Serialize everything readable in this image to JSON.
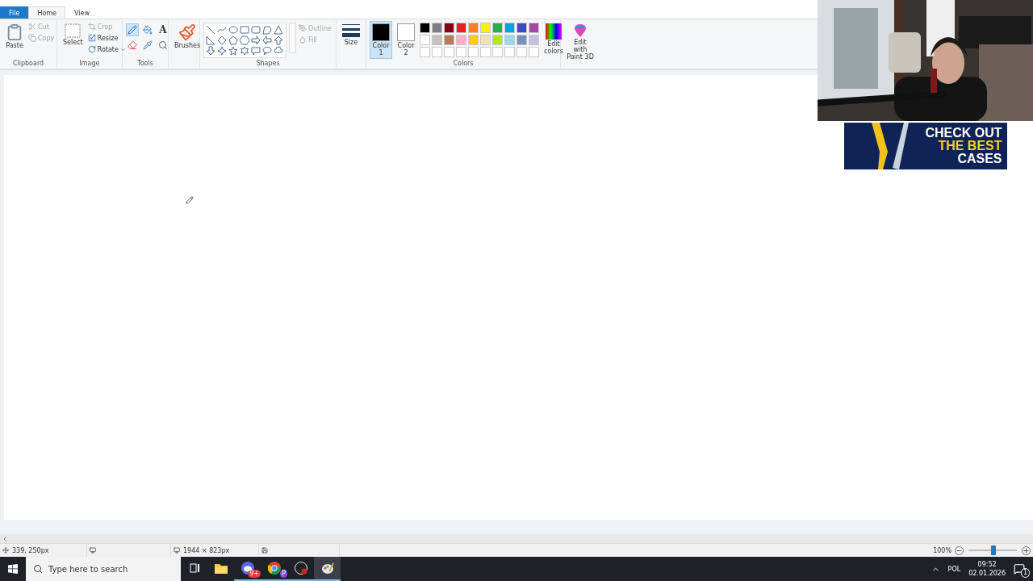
{
  "tabs": [
    {
      "label": "File",
      "kind": "file",
      "selected": false
    },
    {
      "label": "Home",
      "kind": "tab",
      "selected": true
    },
    {
      "label": "View",
      "kind": "tab",
      "selected": false
    }
  ],
  "ribbon": {
    "clipboard": {
      "label": "Clipboard",
      "paste": "Paste",
      "small": [
        {
          "label": "Cut",
          "kind": "cut",
          "disabled": true
        },
        {
          "label": "Copy",
          "kind": "copy",
          "disabled": true
        }
      ]
    },
    "image": {
      "label": "Image",
      "select": "Select",
      "small": [
        {
          "label": "Crop",
          "kind": "crop",
          "disabled": true
        },
        {
          "label": "Resize",
          "kind": "resize",
          "disabled": false
        },
        {
          "label": "Rotate",
          "kind": "rotate",
          "disabled": false
        }
      ]
    },
    "tools": {
      "label": "Tools",
      "items": [
        {
          "kind": "pencil",
          "selected": true
        },
        {
          "kind": "fill",
          "selected": false
        },
        {
          "kind": "text",
          "glyph": "A",
          "selected": false
        },
        {
          "kind": "eraser",
          "selected": false
        },
        {
          "kind": "picker",
          "selected": false
        },
        {
          "kind": "magnifier",
          "selected": false
        }
      ]
    },
    "brushes": {
      "button": "Brushes"
    },
    "shapes": {
      "label": "Shapes",
      "outline": {
        "label": "Outline",
        "disabled": true
      },
      "fill": {
        "label": "Fill",
        "disabled": true
      }
    },
    "size": {
      "button": "Size"
    },
    "colors": {
      "label": "Colors",
      "slots": [
        {
          "label": "Color 1",
          "color": "#000000",
          "selected": true
        },
        {
          "label": "Color 2",
          "color": "#ffffff",
          "selected": false
        }
      ],
      "palette": [
        {
          "color": "#000000"
        },
        {
          "color": "#7f7f7f"
        },
        {
          "color": "#880015"
        },
        {
          "color": "#ed1c24"
        },
        {
          "color": "#ff7f27"
        },
        {
          "color": "#fff200"
        },
        {
          "color": "#22b14c"
        },
        {
          "color": "#00a2e8"
        },
        {
          "color": "#3f48cc"
        },
        {
          "color": "#a349a4"
        },
        {
          "color": "#ffffff"
        },
        {
          "color": "#c3c3c3"
        },
        {
          "color": "#b97a57"
        },
        {
          "color": "#ffaec9"
        },
        {
          "color": "#ffc90e"
        },
        {
          "color": "#efe4b0"
        },
        {
          "color": "#b5e61d"
        },
        {
          "color": "#99d9ea"
        },
        {
          "color": "#7092be"
        },
        {
          "color": "#c8bfe7"
        }
      ],
      "edit_colors": "Edit colors"
    },
    "paint3d": {
      "button": "Edit with Paint 3D"
    }
  },
  "stream_overlay": {
    "banner": {
      "lines": [
        {
          "text": "CHECK OUT",
          "color": "#ffffff"
        },
        {
          "text": "THE BEST",
          "color": "#ffd21f"
        },
        {
          "text": "CASES",
          "color": "#ffffff"
        }
      ]
    }
  },
  "status_bar": {
    "position": "339, 250px",
    "canvas_size": "1944 × 823px",
    "zoom": "100%",
    "zoom_slider": {
      "level": 0.52
    }
  },
  "taskbar": {
    "search": {
      "placeholder": "Type here to search"
    },
    "apps": [
      {
        "kind": "taskview",
        "running": false,
        "active": false
      },
      {
        "kind": "explorer",
        "running": false,
        "active": false
      },
      {
        "kind": "chat",
        "badge": "9+",
        "running": true,
        "active": false
      },
      {
        "kind": "browser",
        "badge": "P",
        "running": true,
        "active": false
      },
      {
        "kind": "recorder",
        "running": true,
        "active": false
      },
      {
        "kind": "paint",
        "running": true,
        "active": true
      }
    ],
    "tray": {
      "language": "POL",
      "time": "09:52",
      "date": "02.01.2026",
      "notifications": "1"
    }
  }
}
